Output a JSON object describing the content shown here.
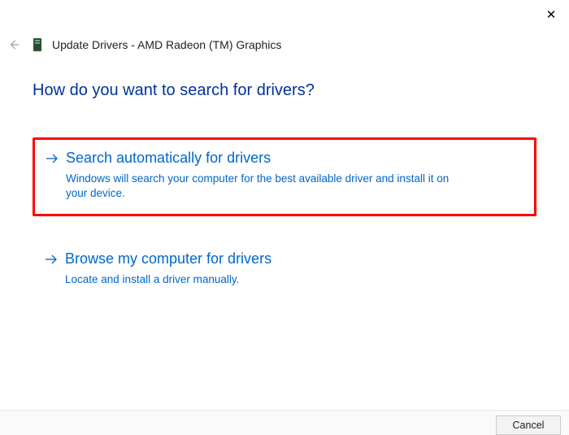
{
  "titlebar": {
    "close_label": "✕"
  },
  "header": {
    "title": "Update Drivers - AMD Radeon (TM) Graphics"
  },
  "main": {
    "heading": "How do you want to search for drivers?",
    "options": [
      {
        "title": "Search automatically for drivers",
        "desc": "Windows will search your computer for the best available driver and install it on your device."
      },
      {
        "title": "Browse my computer for drivers",
        "desc": "Locate and install a driver manually."
      }
    ]
  },
  "footer": {
    "cancel_label": "Cancel"
  }
}
